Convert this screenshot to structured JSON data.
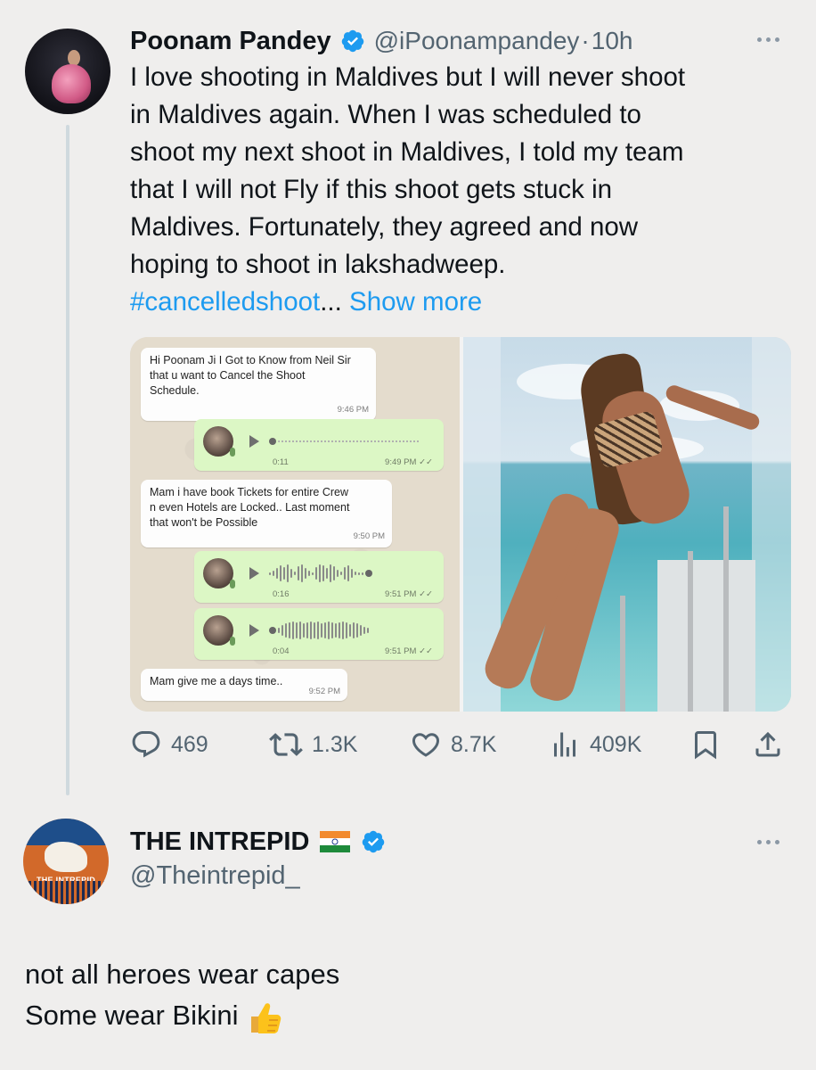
{
  "tweet1": {
    "author_name": "Poonam Pandey",
    "handle": "@iPoonampandey",
    "separator": "·",
    "time": "10h",
    "verified_icon": "verified-badge-icon",
    "text_lines": [
      "I love shooting in Maldives but I will never shoot",
      "in Maldives again. When I was scheduled to",
      "shoot my next shoot in Maldives, I told my team",
      "that I will not Fly if this shoot gets stuck in",
      "Maldives. Fortunately, they agreed and now",
      "hoping to shoot in lakshadweep."
    ],
    "hashtag": "#cancelledshoot",
    "ellipsis": "...",
    "show_more": "Show more",
    "media": {
      "chat": {
        "msg1": {
          "lines": [
            "Hi Poonam Ji I Got to Know from Neil Sir",
            "that u want to Cancel the Shoot",
            "Schedule."
          ],
          "time": "9:46 PM"
        },
        "voice1": {
          "duration": "0:11",
          "time": "9:49 PM ✓✓"
        },
        "msg2": {
          "lines": [
            "Mam i have book Tickets for entire Crew",
            "n even Hotels are Locked.. Last moment",
            "that won't be Possible"
          ],
          "time": "9:50 PM"
        },
        "voice2": {
          "duration": "0:16",
          "time": "9:51 PM ✓✓"
        },
        "voice3": {
          "duration": "0:04",
          "time": "9:51 PM ✓✓"
        },
        "msg3": {
          "lines": [
            "Mam give me a days time.."
          ],
          "time": "9:52 PM"
        }
      }
    },
    "actions": {
      "replies": "469",
      "retweets": "1.3K",
      "likes": "8.7K",
      "views": "409K",
      "icons": [
        "reply-icon",
        "retweet-icon",
        "like-icon",
        "views-icon",
        "bookmark-icon",
        "share-icon"
      ]
    }
  },
  "tweet2": {
    "author_name": "THE INTREPID",
    "flag_icon": "india-flag-icon",
    "handle": "@Theintrepid_",
    "avatar_label": "THE INTREPID",
    "text_lines": [
      "not all heroes wear capes",
      "Some wear Bikini"
    ],
    "emoji_icon": "thumbs-up-icon"
  },
  "colors": {
    "background": "#efeeed",
    "link": "#1d9bf0",
    "secondary_text": "#536471",
    "verified": "#1d9bf0"
  }
}
